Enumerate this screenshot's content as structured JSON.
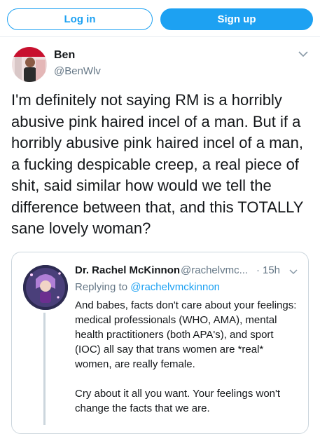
{
  "header": {
    "login_label": "Log in",
    "signup_label": "Sign up",
    "accent_color": "#1da1f2"
  },
  "tweet": {
    "author_name": "Ben",
    "author_handle": "@BenWlv",
    "text": "I'm definitely not saying RM is a horribly abusive pink haired incel of a man. But if a horribly abusive pink haired incel of a man, a fucking despicable creep, a real piece of shit, said similar how would we tell the difference between that, and this TOTALLY sane lovely woman?",
    "menu_icon": "chevron-down-icon"
  },
  "quoted_tweet": {
    "author_name": "Dr. Rachel McKinnon",
    "author_handle": "@rachelvmc...",
    "separator": "·",
    "time": "15h",
    "replying_prefix": "Replying to",
    "replying_handle": "@rachelvmckinnon",
    "paragraph_1": "And babes, facts don't care about your feelings: medical professionals (WHO, AMA), mental health practitioners (both APA's), and sport (IOC) all say that trans women are *real* women, are really female.",
    "paragraph_2": "Cry about it all you want. Your feelings won't change the facts that we are."
  }
}
